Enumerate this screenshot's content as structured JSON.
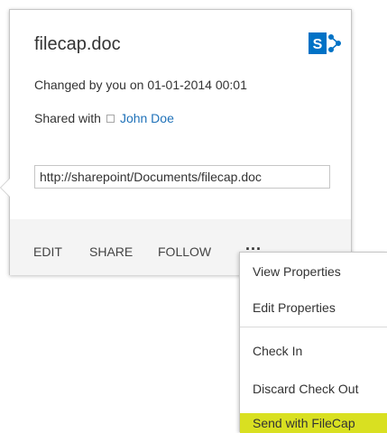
{
  "callout": {
    "title": "filecap.doc",
    "changed": "Changed by you on 01-01-2014  00:01",
    "shared_prefix": "Shared with",
    "shared_person": "John Doe",
    "url": "http://sharepoint/Documents/filecap.doc"
  },
  "logo": {
    "letter": "S",
    "name": "sharepoint-logo",
    "color": "#0072c6"
  },
  "actions": {
    "edit": "EDIT",
    "share": "SHARE",
    "follow": "FOLLOW",
    "more": "..."
  },
  "menu": {
    "view_properties": "View Properties",
    "edit_properties": "Edit Properties",
    "check_in": "Check In",
    "discard_check_out": "Discard Check Out",
    "send_with_filecap": "Send with FileCap"
  },
  "colors": {
    "link": "#2072b9",
    "highlight": "#d9e021",
    "footer_bg": "#f4f4f4"
  }
}
